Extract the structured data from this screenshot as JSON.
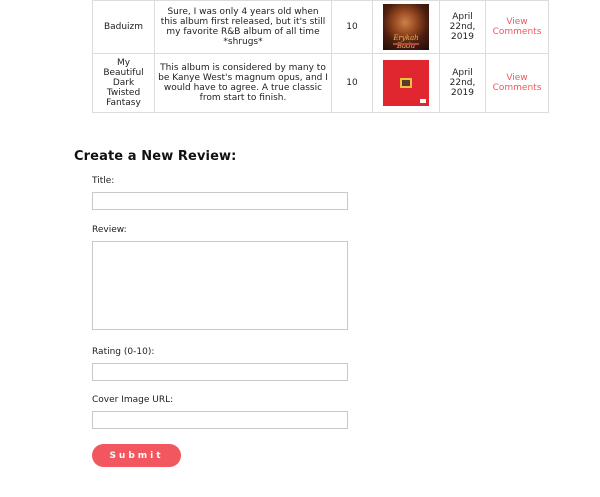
{
  "reviews": [
    {
      "title": "Baduizm",
      "review": "Sure, I was only 4 years old when this album first released, but it's still my favorite R&B album of all time *shrugs*",
      "rating": "10",
      "cover_text": "Erykah Badu",
      "cover_alt": "Baduizm album cover",
      "date": "April 22nd, 2019",
      "link": "View Comments"
    },
    {
      "title": "My Beautiful Dark Twisted Fantasy",
      "review": "This album is considered by many to be Kanye West's magnum opus, and I would have to agree. A true classic from start to finish.",
      "rating": "10",
      "cover_alt": "My Beautiful Dark Twisted Fantasy album cover",
      "date": "April 22nd, 2019",
      "link": "View Comments"
    }
  ],
  "form": {
    "heading": "Create a New Review:",
    "title_label": "Title:",
    "title_value": "",
    "review_label": "Review:",
    "review_value": "",
    "rating_label": "Rating (0-10):",
    "rating_value": "",
    "cover_label": "Cover Image URL:",
    "cover_value": "",
    "submit_label": "Submit"
  },
  "colors": {
    "accent": "#f2565e",
    "border": "#dcdcdc"
  }
}
